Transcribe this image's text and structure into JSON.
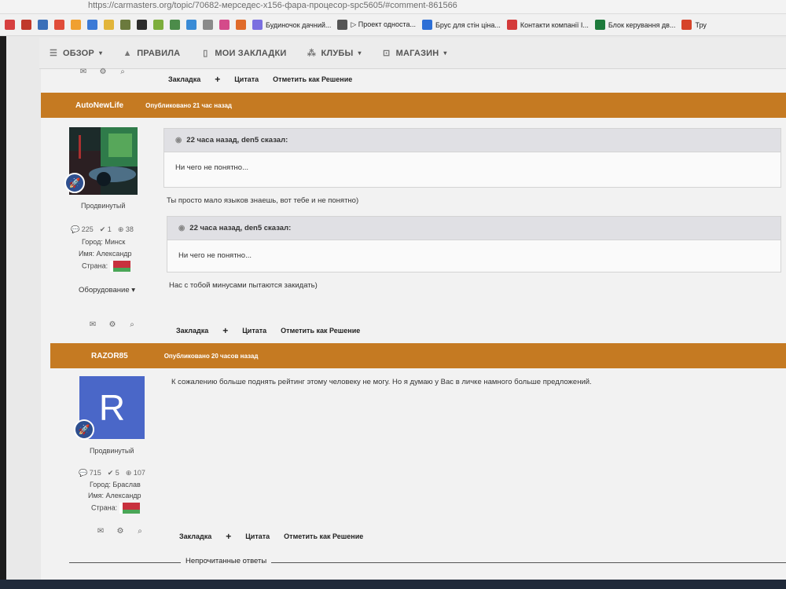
{
  "browser": {
    "url": "https://carmasters.org/topic/70682-мерседес-x156-фара-процесор-spc5605/#comment-861566",
    "bookmarks": [
      {
        "label": "Будиночок дачний...",
        "color": "#7b6fe0"
      },
      {
        "label": "▷ Проект односта...",
        "color": "#555555"
      },
      {
        "label": "Брус для стін ціна...",
        "color": "#2d6fd6"
      },
      {
        "label": "Контакти компанії І...",
        "color": "#d43a3a"
      },
      {
        "label": "Блок керування дв...",
        "color": "#1d7a3b"
      },
      {
        "label": "Тру",
        "color": "#d6442a"
      }
    ]
  },
  "nav": {
    "items": [
      {
        "label": "ОБЗОР",
        "icon": "list-icon",
        "dropdown": true
      },
      {
        "label": "ПРАВИЛА",
        "icon": "warning-icon",
        "dropdown": false
      },
      {
        "label": "МОИ ЗАКЛАДКИ",
        "icon": "bookmark-icon",
        "dropdown": false
      },
      {
        "label": "КЛУБЫ",
        "icon": "clubs-icon",
        "dropdown": true
      },
      {
        "label": "МАГАЗИН",
        "icon": "cart-icon",
        "dropdown": true
      }
    ]
  },
  "controls": {
    "bookmark": "Закладка",
    "plus": "+",
    "quote": "Цитата",
    "solution": "Отметить как Решение"
  },
  "posts": [
    {
      "author": "AutoNewLife",
      "posted": "Опубликовано 21 час назад",
      "rank": "Продвинутый",
      "stats": {
        "comments": "225",
        "rep": "1",
        "points": "38"
      },
      "city": "Город: Минск",
      "name": "Имя: Александр",
      "country": "Страна:",
      "equipment": "Оборудование",
      "quotes": [
        {
          "head": "22 часа назад, den5 сказал:",
          "body": "Ни чего не понятно..."
        },
        {
          "head": "22 часа назад, den5 сказал:",
          "body": "Ни чего не понятно..."
        }
      ],
      "replies": [
        "Ты просто мало языков знаешь, вот тебе и не понятно)",
        "Нас с тобой минусами пытаются закидать)"
      ]
    },
    {
      "author": "RAZOR85",
      "posted": "Опубликовано 20 часов назад",
      "rank": "Продвинутый",
      "avatar_letter": "R",
      "stats": {
        "comments": "715",
        "rep": "5",
        "points": "107"
      },
      "city": "Город: Браслав",
      "name": "Имя: Александр",
      "country": "Страна:",
      "message": "К сожалению больше поднять рейтинг этому человеку не могу. Но я думаю у Вас в личке намного больше предложений."
    }
  ],
  "footer": {
    "unread": "Непрочитанные ответы"
  }
}
